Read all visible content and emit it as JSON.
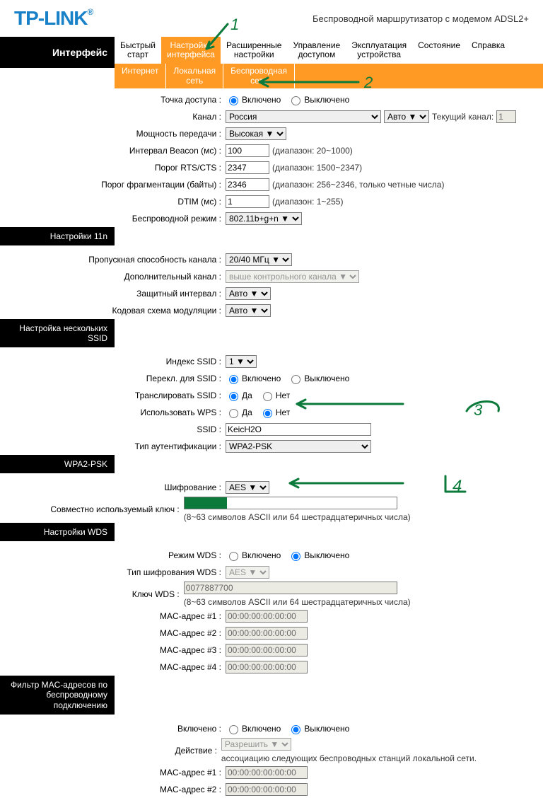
{
  "header": {
    "logo_text": "TP-LINK",
    "reg": "®",
    "subtitle": "Беспроводной маршрутизатор с модемом ADSL2+"
  },
  "sidebar": {
    "interface": "Интерфейс",
    "s11n": "Настройки 11n",
    "multi_ssid": "Настройка нескольких SSID",
    "wpa2": "WPA2-PSK",
    "wds": "Настройки WDS",
    "macfilter": "Фильтр MAC-адресов по беспроводному подключению"
  },
  "topnav": {
    "quick": "Быстрый\nстарт",
    "iface": "Настройка\nинтерфейса",
    "adv": "Расширенные\nнастройки",
    "access": "Управление\nдоступом",
    "maint": "Эксплуатация\nустройства",
    "status": "Состояние",
    "help": "Справка"
  },
  "subnav": {
    "internet": "Интернет",
    "lan": "Локальная\nсеть",
    "wlan": "Беспроводная\nсеть"
  },
  "labels": {
    "ap": "Точка доступа :",
    "channel": "Канал :",
    "txpower": "Мощность передачи :",
    "beacon": "Интервал Beacon (мс) :",
    "rts": "Порог RTS/CTS :",
    "frag": "Порог фрагментации (байты) :",
    "dtim": "DTIM (мс) :",
    "wmode": "Беспроводной режим :",
    "bw": "Пропускная способность канала :",
    "extch": "Дополнительный канал :",
    "gi": "Защитный интервал :",
    "mcs": "Кодовая схема модуляции :",
    "ssid_idx": "Индекс SSID :",
    "ssid_sw": "Перекл. для SSID :",
    "bcast": "Транслировать SSID :",
    "wps": "Использовать WPS :",
    "ssid": "SSID :",
    "auth": "Тип аутентификации :",
    "enc": "Шифрование :",
    "psk": "Совместно используемый ключ :",
    "wds_mode": "Режим WDS :",
    "wds_enc": "Тип шифрования WDS :",
    "wds_key": "Ключ WDS :",
    "mac1": "MAC-адрес #1 :",
    "mac2": "MAC-адрес #2 :",
    "mac3": "MAC-адрес #3 :",
    "mac4": "MAC-адрес #4 :",
    "mf_en": "Включено :",
    "mf_act": "Действие :",
    "mf_mac1": "MAC-адрес #1 :",
    "mf_mac2": "MAC-адрес #2 :"
  },
  "opts": {
    "on": "Включено",
    "off": "Выключено",
    "yes": "Да",
    "no": "Нет",
    "country": "Россия",
    "chan_auto": "Авто ▼",
    "cur_chan_lbl": "Текущий канал:",
    "cur_chan_val": "1",
    "txpower": "Высокая ▼",
    "beacon": "100",
    "beacon_hint": "(диапазон: 20~1000)",
    "rts": "2347",
    "rts_hint": "(диапазон: 1500~2347)",
    "frag": "2346",
    "frag_hint": "(диапазон: 256~2346, только четные числа)",
    "dtim": "1",
    "dtim_hint": "(диапазон: 1~255)",
    "wmode": "802.11b+g+n ▼",
    "bw": "20/40 МГц ▼",
    "extch": "выше контрольного канала ▼",
    "gi": "Авто   ▼",
    "mcs": "Авто ▼",
    "ssid_idx": "1 ▼",
    "ssid": "KeicH2O",
    "auth": "WPA2-PSK",
    "enc": "AES       ▼",
    "psk_hint": "(8~63 символов ASCII или 64 шестрадцатеричных числа)",
    "wds_enc": "AES   ▼",
    "wds_key": "0077887700",
    "mac_zero": "00:00:00:00:00:00",
    "mf_act": "Разрешить ▼",
    "mf_act_tail": " ассоциацию следующих беспроводных станций локальной сети."
  },
  "anno": {
    "n1": "1",
    "n2": "2",
    "n3": "3",
    "n4": "4"
  }
}
